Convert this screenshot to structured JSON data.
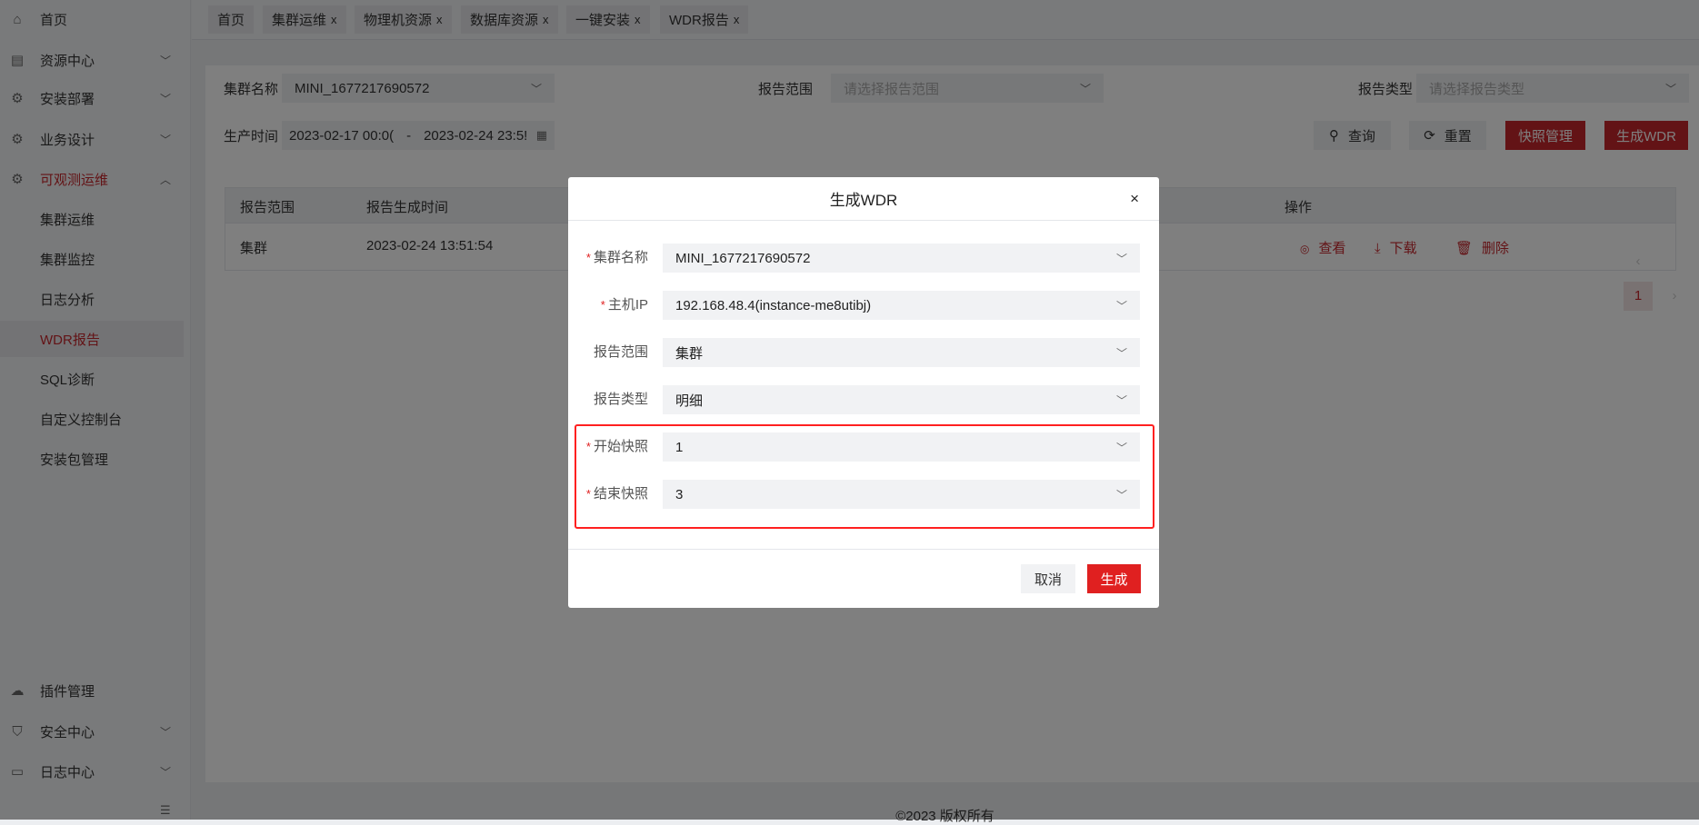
{
  "sidebar": {
    "items": [
      {
        "label": "首页",
        "icon": "home-icon"
      },
      {
        "label": "资源中心",
        "icon": "server-icon"
      },
      {
        "label": "安装部署",
        "icon": "gear-icon"
      },
      {
        "label": "业务设计",
        "icon": "gear-icon"
      },
      {
        "label": "可观测运维",
        "icon": "gear-icon"
      }
    ],
    "sub_items": [
      "集群运维",
      "集群监控",
      "日志分析",
      "WDR报告",
      "SQL诊断",
      "自定义控制台",
      "安装包管理"
    ],
    "bottom_items": [
      {
        "label": "插件管理",
        "icon": "plugin-icon"
      },
      {
        "label": "安全中心",
        "icon": "shield-icon"
      },
      {
        "label": "日志中心",
        "icon": "document-icon"
      }
    ]
  },
  "tabs": [
    {
      "label": "首页"
    },
    {
      "label": "集群运维",
      "close": "x"
    },
    {
      "label": "物理机资源",
      "close": "x"
    },
    {
      "label": "数据库资源",
      "close": "x"
    },
    {
      "label": "一键安装",
      "close": "x"
    },
    {
      "label": "WDR报告",
      "close": "x"
    }
  ],
  "filters": {
    "cluster_label": "集群名称",
    "cluster_value": "MINI_1677217690572",
    "scope_label": "报告范围",
    "scope_placeholder": "请选择报告范围",
    "type_label": "报告类型",
    "type_placeholder": "请选择报告类型",
    "time_label": "生产时间",
    "time_start": "2023-02-17 00:0(",
    "time_sep": "-",
    "time_end": "2023-02-24 23:5!"
  },
  "buttons": {
    "query": "查询",
    "reset": "重置",
    "snapshot": "快照管理",
    "generate": "生成WDR"
  },
  "table": {
    "headers": [
      "报告范围",
      "报告生成时间",
      "操作"
    ],
    "rows": [
      {
        "scope": "集群",
        "time": "2023-02-24 13:51:54",
        "actions": [
          "查看",
          "下载",
          "删除"
        ]
      }
    ]
  },
  "pagination": {
    "current": "1"
  },
  "footer": "©2023 版权所有",
  "modal": {
    "title": "生成WDR",
    "close": "×",
    "fields": [
      {
        "label": "集群名称",
        "value": "MINI_1677217690572",
        "required": "*"
      },
      {
        "label": "主机IP",
        "value": "192.168.48.4(instance-me8utibj)",
        "required": "*"
      },
      {
        "label": "报告范围",
        "value": "集群"
      },
      {
        "label": "报告类型",
        "value": "明细"
      },
      {
        "label": "开始快照",
        "value": "1",
        "required": "*"
      },
      {
        "label": "结束快照",
        "value": "3",
        "required": "*"
      }
    ],
    "cancel": "取消",
    "submit": "生成"
  },
  "colors": {
    "accent": "#c7262c",
    "submit": "#e02020",
    "highlight": "#ff2020"
  }
}
